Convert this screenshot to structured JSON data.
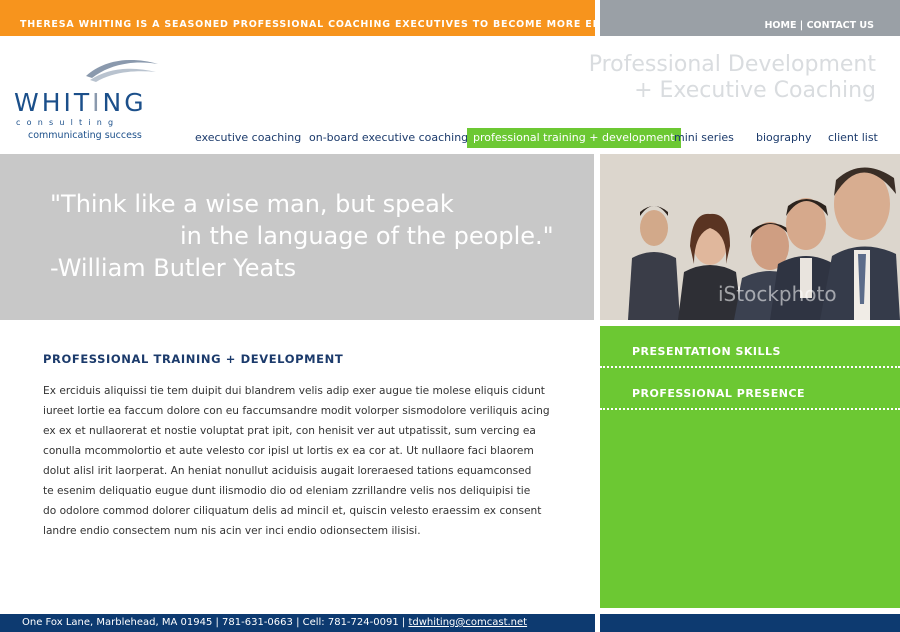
{
  "header": {
    "tagline": "THERESA WHITING IS A SEASONED PROFESSIONAL COACHING EXECUTIVES TO BECOME MORE EFFECTIVE LEADERS.",
    "links": {
      "home": "HOME",
      "separator": "|",
      "contact": "CONTACT US"
    },
    "title_line1": "Professional Development",
    "title_line2": "+ Executive Coaching"
  },
  "logo": {
    "word_a": "WHIT",
    "word_b": "I",
    "word_c": "NG",
    "sub": "consulting",
    "slogan": "communicating success"
  },
  "nav": {
    "items": [
      {
        "label": "executive coaching"
      },
      {
        "label": "on-board executive coaching"
      },
      {
        "label": "professional training + development"
      },
      {
        "label": "mini series"
      },
      {
        "label": "biography"
      },
      {
        "label": "client list"
      }
    ],
    "active_index": 2
  },
  "quote": {
    "line1": "\"Think like a wise man, but speak",
    "line2": "in the language of the people.\"",
    "line3": "-William Butler Yeats"
  },
  "photo": {
    "watermark": "iStockphoto"
  },
  "main": {
    "heading": "PROFESSIONAL TRAINING + DEVELOPMENT",
    "lines": [
      "Ex erciduis aliquissi tie tem duipit dui blandrem velis adip exer augue tie molese eliquis cidunt",
      "iureet lortie ea faccum dolore con eu faccumsandre modit volorper sismodolore veriliquis acing",
      "ex ex et nullaorerat et nostie voluptat prat ipit, con henisit ver aut utpatissit, sum vercing ea",
      "conulla mcommolortio et aute velesto cor ipisl ut lortis ex ea cor at. Ut nullaore faci blaorem",
      "dolut alisl irit laorperat. An heniat nonullut aciduisis augait loreraesed tations equamconsed",
      "te esenim deliquatio eugue dunt ilismodio dio od eleniam zzrillandre velis nos deliquipisi tie",
      "do odolore commod dolorer ciliquatum delis ad mincil et, quiscin velesto eraessim ex consent",
      "landre endio consectem num nis acin ver inci endio odionsectem ilisisi."
    ]
  },
  "sidebar": {
    "items": [
      {
        "label": "PRESENTATION SKILLS"
      },
      {
        "label": "PROFESSIONAL PRESENCE"
      }
    ]
  },
  "footer": {
    "address": "One Fox Lane, Marblehead, MA 01945 | 781-631-0663 | Cell: 781-724-0091 |",
    "email": "tdwhiting@comcast.net"
  },
  "colors": {
    "orange": "#f7941d",
    "green": "#6cc833",
    "navy": "#0d3a70",
    "gray": "#9aa0a6",
    "quote_band": "#c8c8c8"
  }
}
